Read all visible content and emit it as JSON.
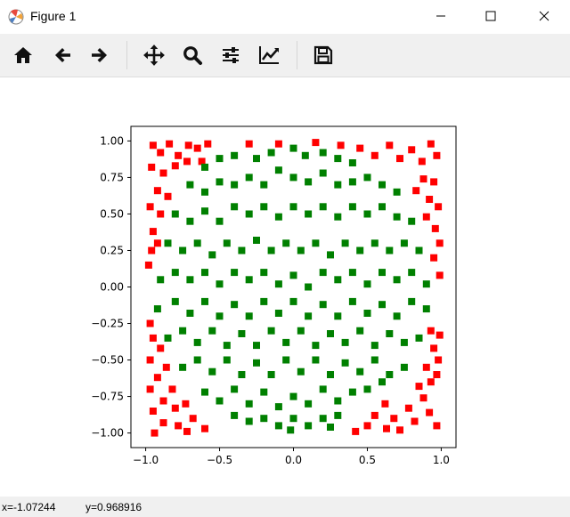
{
  "window": {
    "title": "Figure 1",
    "controls": [
      "minimize",
      "maximize",
      "close"
    ]
  },
  "toolbar": {
    "buttons": [
      {
        "name": "home",
        "icon": "home-icon"
      },
      {
        "name": "back",
        "icon": "arrow-left-icon"
      },
      {
        "name": "forward",
        "icon": "arrow-right-icon"
      },
      {
        "name": "pan",
        "icon": "move-icon"
      },
      {
        "name": "zoom",
        "icon": "magnifier-icon"
      },
      {
        "name": "configure-subplots",
        "icon": "sliders-icon"
      },
      {
        "name": "edit-axis",
        "icon": "line-chart-icon"
      },
      {
        "name": "save",
        "icon": "floppy-icon"
      }
    ]
  },
  "status": {
    "x": "x=-1.07244",
    "y": "y=0.968916"
  },
  "chart_data": {
    "type": "scatter",
    "marker": "square",
    "xlim": [
      -1.1,
      1.1
    ],
    "ylim": [
      -1.1,
      1.1
    ],
    "xticks": [
      "−1.0",
      "−0.5",
      "0.0",
      "0.5",
      "1.0"
    ],
    "yticks": [
      "1.00",
      "0.75",
      "0.50",
      "0.25",
      "0.00",
      "−0.25",
      "−0.50",
      "−0.75",
      "−1.00"
    ],
    "xtick_values": [
      -1.0,
      -0.5,
      0.0,
      0.5,
      1.0
    ],
    "ytick_values": [
      1.0,
      0.75,
      0.5,
      0.25,
      0.0,
      -0.25,
      -0.5,
      -0.75,
      -1.0
    ],
    "grid": false,
    "series": [
      {
        "color": "#ff0000",
        "rule": "outside unit circle",
        "points": [
          [
            -0.95,
            0.97
          ],
          [
            -0.9,
            0.92
          ],
          [
            -0.84,
            0.98
          ],
          [
            -0.78,
            0.9
          ],
          [
            -0.71,
            0.97
          ],
          [
            -0.96,
            0.82
          ],
          [
            -0.88,
            0.78
          ],
          [
            -0.92,
            0.66
          ],
          [
            -0.97,
            0.55
          ],
          [
            -0.9,
            0.5
          ],
          [
            -0.95,
            0.38
          ],
          [
            -0.85,
            0.62
          ],
          [
            -0.8,
            0.83
          ],
          [
            -0.65,
            0.95
          ],
          [
            -0.58,
            0.98
          ],
          [
            -0.96,
            0.25
          ],
          [
            -0.92,
            0.3
          ],
          [
            -0.98,
            0.15
          ],
          [
            -0.72,
            0.86
          ],
          [
            -0.62,
            0.86
          ],
          [
            -0.3,
            0.98
          ],
          [
            -0.1,
            0.98
          ],
          [
            0.15,
            0.99
          ],
          [
            0.32,
            0.97
          ],
          [
            0.45,
            0.95
          ],
          [
            0.55,
            0.9
          ],
          [
            0.65,
            0.97
          ],
          [
            0.72,
            0.88
          ],
          [
            0.8,
            0.94
          ],
          [
            0.87,
            0.86
          ],
          [
            0.93,
            0.98
          ],
          [
            0.97,
            0.9
          ],
          [
            0.88,
            0.74
          ],
          [
            0.95,
            0.72
          ],
          [
            0.83,
            0.66
          ],
          [
            0.92,
            0.6
          ],
          [
            0.98,
            0.55
          ],
          [
            0.9,
            0.48
          ],
          [
            0.96,
            0.4
          ],
          [
            0.99,
            0.3
          ],
          [
            0.95,
            0.2
          ],
          [
            0.99,
            0.08
          ],
          [
            -0.97,
            -0.25
          ],
          [
            -0.95,
            -0.35
          ],
          [
            -0.9,
            -0.42
          ],
          [
            -0.97,
            -0.5
          ],
          [
            -0.86,
            -0.55
          ],
          [
            -0.92,
            -0.62
          ],
          [
            -0.97,
            -0.7
          ],
          [
            -0.82,
            -0.7
          ],
          [
            -0.88,
            -0.78
          ],
          [
            -0.95,
            -0.85
          ],
          [
            -0.8,
            -0.83
          ],
          [
            -0.73,
            -0.8
          ],
          [
            -0.88,
            -0.93
          ],
          [
            -0.78,
            -0.95
          ],
          [
            -0.68,
            -0.9
          ],
          [
            -0.6,
            -0.97
          ],
          [
            -0.94,
            -1.0
          ],
          [
            -0.72,
            -0.99
          ],
          [
            0.55,
            -0.88
          ],
          [
            0.62,
            -0.8
          ],
          [
            0.5,
            -0.95
          ],
          [
            0.68,
            -0.9
          ],
          [
            0.72,
            -0.98
          ],
          [
            0.78,
            -0.83
          ],
          [
            0.82,
            -0.92
          ],
          [
            0.88,
            -0.76
          ],
          [
            0.92,
            -0.86
          ],
          [
            0.97,
            -0.95
          ],
          [
            0.85,
            -0.68
          ],
          [
            0.93,
            -0.65
          ],
          [
            0.97,
            -0.6
          ],
          [
            0.9,
            -0.55
          ],
          [
            0.98,
            -0.5
          ],
          [
            0.95,
            -0.42
          ],
          [
            0.99,
            -0.33
          ],
          [
            0.93,
            -0.3
          ],
          [
            0.42,
            -0.99
          ],
          [
            0.63,
            -0.97
          ]
        ]
      },
      {
        "color": "#008000",
        "rule": "inside unit circle",
        "points": [
          [
            -0.6,
            0.82
          ],
          [
            -0.5,
            0.88
          ],
          [
            -0.4,
            0.9
          ],
          [
            -0.25,
            0.88
          ],
          [
            -0.15,
            0.92
          ],
          [
            0.0,
            0.95
          ],
          [
            0.08,
            0.9
          ],
          [
            0.2,
            0.92
          ],
          [
            0.3,
            0.88
          ],
          [
            0.4,
            0.85
          ],
          [
            -0.7,
            0.7
          ],
          [
            -0.6,
            0.65
          ],
          [
            -0.5,
            0.72
          ],
          [
            -0.4,
            0.7
          ],
          [
            -0.3,
            0.75
          ],
          [
            -0.2,
            0.7
          ],
          [
            -0.1,
            0.8
          ],
          [
            0.0,
            0.75
          ],
          [
            0.1,
            0.72
          ],
          [
            0.2,
            0.78
          ],
          [
            0.3,
            0.7
          ],
          [
            0.4,
            0.72
          ],
          [
            0.5,
            0.75
          ],
          [
            0.6,
            0.7
          ],
          [
            0.7,
            0.65
          ],
          [
            -0.8,
            0.5
          ],
          [
            -0.7,
            0.45
          ],
          [
            -0.6,
            0.52
          ],
          [
            -0.5,
            0.45
          ],
          [
            -0.4,
            0.55
          ],
          [
            -0.3,
            0.5
          ],
          [
            -0.2,
            0.55
          ],
          [
            -0.1,
            0.48
          ],
          [
            0.0,
            0.55
          ],
          [
            0.1,
            0.5
          ],
          [
            0.2,
            0.55
          ],
          [
            0.3,
            0.48
          ],
          [
            0.4,
            0.55
          ],
          [
            0.5,
            0.5
          ],
          [
            0.6,
            0.55
          ],
          [
            0.7,
            0.48
          ],
          [
            0.8,
            0.45
          ],
          [
            -0.85,
            0.3
          ],
          [
            -0.75,
            0.25
          ],
          [
            -0.65,
            0.3
          ],
          [
            -0.55,
            0.22
          ],
          [
            -0.45,
            0.3
          ],
          [
            -0.35,
            0.25
          ],
          [
            -0.25,
            0.32
          ],
          [
            -0.15,
            0.25
          ],
          [
            -0.05,
            0.3
          ],
          [
            0.05,
            0.25
          ],
          [
            0.15,
            0.3
          ],
          [
            0.25,
            0.22
          ],
          [
            0.35,
            0.3
          ],
          [
            0.45,
            0.25
          ],
          [
            0.55,
            0.3
          ],
          [
            0.65,
            0.25
          ],
          [
            0.75,
            0.3
          ],
          [
            0.85,
            0.25
          ],
          [
            -0.9,
            0.05
          ],
          [
            -0.8,
            0.1
          ],
          [
            -0.7,
            0.05
          ],
          [
            -0.6,
            0.1
          ],
          [
            -0.5,
            0.02
          ],
          [
            -0.4,
            0.1
          ],
          [
            -0.3,
            0.05
          ],
          [
            -0.2,
            0.1
          ],
          [
            -0.1,
            0.02
          ],
          [
            0.0,
            0.08
          ],
          [
            0.1,
            0.0
          ],
          [
            0.2,
            0.1
          ],
          [
            0.3,
            0.05
          ],
          [
            0.4,
            0.1
          ],
          [
            0.5,
            0.02
          ],
          [
            0.6,
            0.1
          ],
          [
            0.7,
            0.05
          ],
          [
            0.8,
            0.1
          ],
          [
            0.9,
            0.02
          ],
          [
            -0.92,
            -0.15
          ],
          [
            -0.8,
            -0.1
          ],
          [
            -0.7,
            -0.18
          ],
          [
            -0.6,
            -0.1
          ],
          [
            -0.5,
            -0.2
          ],
          [
            -0.4,
            -0.12
          ],
          [
            -0.3,
            -0.2
          ],
          [
            -0.2,
            -0.1
          ],
          [
            -0.1,
            -0.18
          ],
          [
            0.0,
            -0.1
          ],
          [
            0.1,
            -0.2
          ],
          [
            0.2,
            -0.12
          ],
          [
            0.3,
            -0.2
          ],
          [
            0.4,
            -0.1
          ],
          [
            0.5,
            -0.18
          ],
          [
            0.6,
            -0.12
          ],
          [
            0.7,
            -0.2
          ],
          [
            0.8,
            -0.1
          ],
          [
            0.9,
            -0.15
          ],
          [
            -0.85,
            -0.35
          ],
          [
            -0.75,
            -0.3
          ],
          [
            -0.65,
            -0.38
          ],
          [
            -0.55,
            -0.3
          ],
          [
            -0.45,
            -0.4
          ],
          [
            -0.35,
            -0.32
          ],
          [
            -0.25,
            -0.4
          ],
          [
            -0.15,
            -0.3
          ],
          [
            -0.05,
            -0.38
          ],
          [
            0.05,
            -0.3
          ],
          [
            0.15,
            -0.4
          ],
          [
            0.25,
            -0.32
          ],
          [
            0.35,
            -0.38
          ],
          [
            0.45,
            -0.3
          ],
          [
            0.55,
            -0.4
          ],
          [
            0.65,
            -0.32
          ],
          [
            0.75,
            -0.38
          ],
          [
            0.85,
            -0.35
          ],
          [
            -0.75,
            -0.55
          ],
          [
            -0.65,
            -0.5
          ],
          [
            -0.55,
            -0.58
          ],
          [
            -0.45,
            -0.5
          ],
          [
            -0.35,
            -0.6
          ],
          [
            -0.25,
            -0.52
          ],
          [
            -0.15,
            -0.6
          ],
          [
            -0.05,
            -0.5
          ],
          [
            0.05,
            -0.58
          ],
          [
            0.15,
            -0.5
          ],
          [
            0.25,
            -0.6
          ],
          [
            0.35,
            -0.52
          ],
          [
            0.45,
            -0.58
          ],
          [
            0.55,
            -0.5
          ],
          [
            0.65,
            -0.6
          ],
          [
            0.75,
            -0.55
          ],
          [
            -0.6,
            -0.72
          ],
          [
            -0.5,
            -0.78
          ],
          [
            -0.4,
            -0.7
          ],
          [
            -0.3,
            -0.8
          ],
          [
            -0.2,
            -0.72
          ],
          [
            -0.1,
            -0.82
          ],
          [
            0.0,
            -0.75
          ],
          [
            0.1,
            -0.8
          ],
          [
            0.2,
            -0.7
          ],
          [
            0.3,
            -0.78
          ],
          [
            0.4,
            -0.72
          ],
          [
            0.5,
            -0.7
          ],
          [
            0.6,
            -0.65
          ],
          [
            -0.4,
            -0.88
          ],
          [
            -0.3,
            -0.92
          ],
          [
            -0.2,
            -0.9
          ],
          [
            -0.1,
            -0.95
          ],
          [
            0.0,
            -0.9
          ],
          [
            0.1,
            -0.95
          ],
          [
            0.2,
            -0.9
          ],
          [
            0.3,
            -0.88
          ],
          [
            -0.02,
            -0.98
          ],
          [
            0.25,
            -0.96
          ]
        ]
      }
    ]
  }
}
